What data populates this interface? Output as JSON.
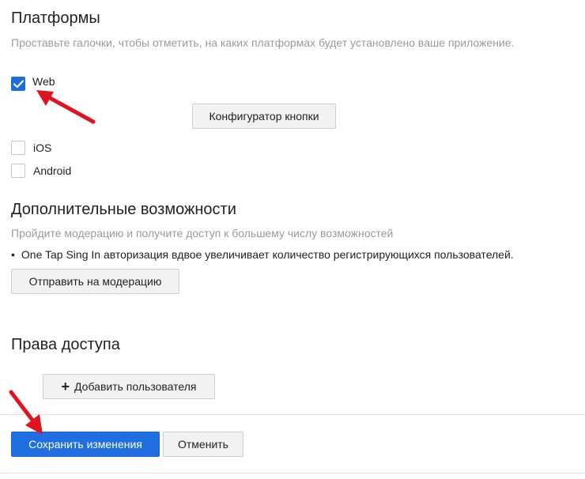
{
  "platforms": {
    "title": "Платформы",
    "description": "Проставьте галочки, чтобы отметить, на каких платформах будет установлено ваше приложение.",
    "items": [
      {
        "label": "Web",
        "checked": true
      },
      {
        "label": "iOS",
        "checked": false
      },
      {
        "label": "Android",
        "checked": false
      }
    ],
    "configurator_button": "Конфигуратор кнопки"
  },
  "extra": {
    "title": "Дополнительные возможности",
    "description": "Пройдите модерацию и получите доступ к большему числу возможностей",
    "bullet": "One Tap Sing In авторизация вдвое увеличивает количество регистрирующихся пользователей.",
    "moderation_button": "Отправить на модерацию"
  },
  "access": {
    "title": "Права доступа",
    "add_user_button": "Добавить пользователя",
    "add_icon": "plus-icon"
  },
  "footer": {
    "save_button": "Сохранить изменения",
    "cancel_button": "Отменить"
  },
  "colors": {
    "primary": "#1f6fe0",
    "checkbox_checked": "#1c6dd8",
    "annotation_arrow": "#e0141e"
  },
  "icons": {
    "check": "check-icon",
    "annotation": "red-arrow-icon"
  }
}
